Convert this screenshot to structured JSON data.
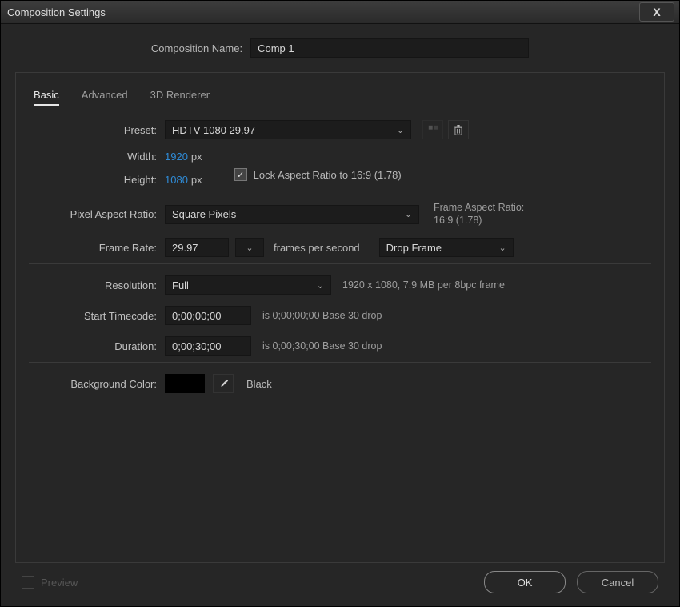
{
  "window": {
    "title": "Composition Settings",
    "close_glyph": "X"
  },
  "comp_name": {
    "label": "Composition Name:",
    "value": "Comp 1"
  },
  "tabs": {
    "basic": "Basic",
    "advanced": "Advanced",
    "renderer": "3D Renderer"
  },
  "preset": {
    "label": "Preset:",
    "value": "HDTV 1080 29.97"
  },
  "width": {
    "label": "Width:",
    "value": "1920",
    "unit": "px"
  },
  "height": {
    "label": "Height:",
    "value": "1080",
    "unit": "px"
  },
  "lock_aspect": {
    "label": "Lock Aspect Ratio to 16:9 (1.78)"
  },
  "pixel_aspect": {
    "label": "Pixel Aspect Ratio:",
    "value": "Square Pixels",
    "note_line1": "Frame Aspect Ratio:",
    "note_line2": "16:9 (1.78)"
  },
  "frame_rate": {
    "label": "Frame Rate:",
    "value": "29.97",
    "fps_text": "frames per second",
    "drop_value": "Drop Frame"
  },
  "resolution": {
    "label": "Resolution:",
    "value": "Full",
    "hint": "1920 x 1080, 7.9 MB per 8bpc frame"
  },
  "start_tc": {
    "label": "Start Timecode:",
    "value": "0;00;00;00",
    "hint": "is 0;00;00;00 Base 30 drop"
  },
  "duration": {
    "label": "Duration:",
    "value": "0;00;30;00",
    "hint": "is 0;00;30;00 Base 30 drop"
  },
  "bg_color": {
    "label": "Background Color:",
    "name": "Black",
    "hex": "#000000"
  },
  "footer": {
    "preview": "Preview",
    "ok": "OK",
    "cancel": "Cancel"
  }
}
